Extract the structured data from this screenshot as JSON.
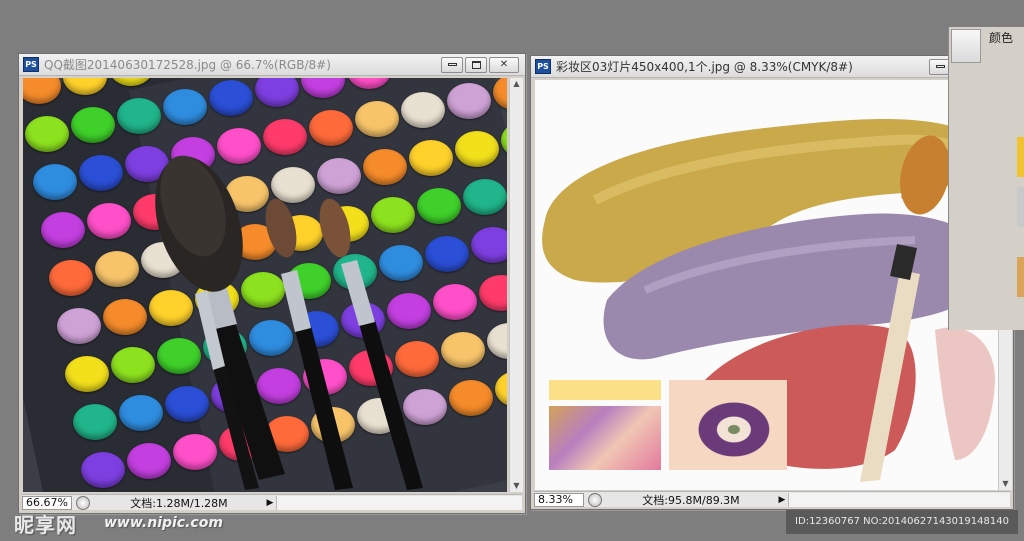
{
  "left_window": {
    "app_icon": "PS",
    "title": "QQ截图20140630172528.jpg @ 66.7%(RGB/8#)",
    "zoom": "66.67%",
    "doc_info": "文档:1.28M/1.28M",
    "image": "eyeshadow-palette-with-brushes"
  },
  "right_window": {
    "app_icon": "PS",
    "title": "彩妆区03灯片450x400,1个.jpg @ 8.33%(CMYK/8#)",
    "zoom": "8.33%",
    "doc_info": "文档:95.8M/89.3M",
    "image": "makeup-strokes-with-brush-and-eye-photos"
  },
  "panel": {
    "label": "颜色"
  },
  "watermark": {
    "logo": "昵享网",
    "url": "www.nipic.com",
    "id_text": "ID:12360767 NO:20140627143019148140"
  },
  "icons": {
    "minimize": "minimize-icon",
    "maximize": "maximize-icon",
    "close": "close-icon",
    "status": "status-icon"
  },
  "colors": {
    "workspace": "#7e7e7e",
    "ps_blue": "#1d4f9c",
    "close_red": "#c8442a"
  }
}
